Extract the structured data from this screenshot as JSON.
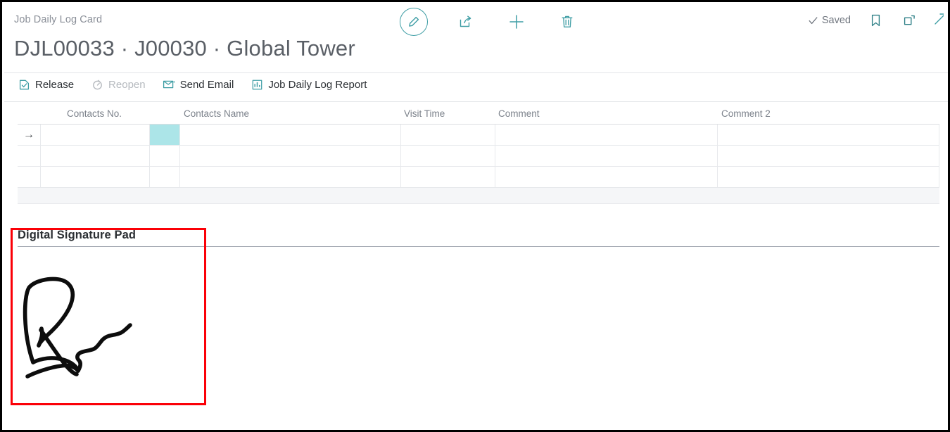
{
  "window": {
    "breadcrumb": "Job Daily Log Card",
    "title": "DJL00033 · J00030 · Global Tower"
  },
  "topbar": {
    "icons": [
      {
        "name": "edit-pencil-icon",
        "label": "Edit"
      },
      {
        "name": "share-icon",
        "label": "Share"
      },
      {
        "name": "plus-icon",
        "label": "New"
      },
      {
        "name": "trash-icon",
        "label": "Delete"
      }
    ],
    "saved_label": "Saved",
    "bookmark_label": "Bookmark",
    "open_new_window_label": "Open in new window"
  },
  "actions": [
    {
      "name": "release-action",
      "label": "Release",
      "icon": "document-check-icon",
      "disabled": false
    },
    {
      "name": "reopen-action",
      "label": "Reopen",
      "icon": "reopen-icon",
      "disabled": true
    },
    {
      "name": "send-email-action",
      "label": "Send Email",
      "icon": "envelope-icon",
      "disabled": false
    },
    {
      "name": "job-daily-log-report-action",
      "label": "Job Daily Log Report",
      "icon": "report-chart-icon",
      "disabled": false
    }
  ],
  "grid": {
    "columns": [
      "Contacts No.",
      "Contacts Name",
      "Visit Time",
      "Comment",
      "Comment 2"
    ],
    "rows": [
      {
        "selected_row": true,
        "contacts_no": "",
        "contacts_name": "",
        "visit_time": "",
        "comment": "",
        "comment_2": ""
      },
      {
        "selected_row": false,
        "contacts_no": "",
        "contacts_name": "",
        "visit_time": "",
        "comment": "",
        "comment_2": ""
      },
      {
        "selected_row": false,
        "contacts_no": "",
        "contacts_name": "",
        "visit_time": "",
        "comment": "",
        "comment_2": ""
      }
    ],
    "row_indicator": "→"
  },
  "signature": {
    "title": "Digital Signature Pad",
    "has_signature": true
  },
  "colors": {
    "accent_teal": "#3f9ea5",
    "selected_cell": "#ace5e8",
    "annotation_red": "#fb0007",
    "muted_text": "#7c828b",
    "disabled_text": "#b6babf"
  }
}
